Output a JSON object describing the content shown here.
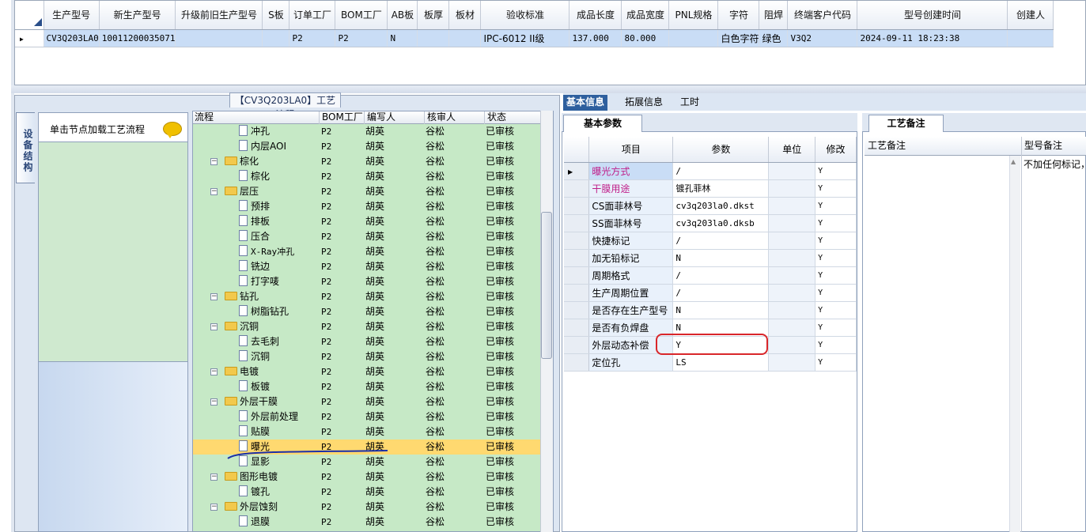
{
  "top_grid": {
    "columns": [
      "生产型号",
      "新生产型号",
      "升级前旧生产型号",
      "S板",
      "订单工厂",
      "BOM工厂",
      "AB板",
      "板厚",
      "板材",
      "验收标准",
      "成品长度",
      "成品宽度",
      "PNL规格",
      "字符",
      "阻焊",
      "终端客户代码",
      "型号创建时间",
      "创建人"
    ],
    "row": [
      "CV3Q203LA0",
      "10011200035071",
      "",
      "",
      "P2",
      "P2",
      "N",
      "",
      "",
      "IPC-6012 II级",
      "137.000",
      "80.000",
      "",
      "白色字符",
      "绿色",
      "V3Q2",
      "2024-09-11 18:23:38",
      ""
    ]
  },
  "flow_title": "【CV3Q203LA0】工艺流程",
  "side_tab": "设备结构",
  "load_hint": "单击节点加载工艺流程",
  "tree": {
    "headers": [
      "流程",
      "BOM工厂",
      "编写人",
      "核审人",
      "状态"
    ],
    "rows": [
      {
        "name": "冲孔",
        "level": 2,
        "bom": "P2",
        "writer": "胡英",
        "reviewer": "谷松",
        "status": "已审核"
      },
      {
        "name": "内层AOI",
        "level": 2,
        "bom": "P2",
        "writer": "胡英",
        "reviewer": "谷松",
        "status": "已审核"
      },
      {
        "name": "棕化",
        "level": 1,
        "bom": "P2",
        "writer": "胡英",
        "reviewer": "谷松",
        "status": "已审核"
      },
      {
        "name": "棕化",
        "level": 2,
        "bom": "P2",
        "writer": "胡英",
        "reviewer": "谷松",
        "status": "已审核"
      },
      {
        "name": "层压",
        "level": 1,
        "bom": "P2",
        "writer": "胡英",
        "reviewer": "谷松",
        "status": "已审核"
      },
      {
        "name": "预排",
        "level": 2,
        "bom": "P2",
        "writer": "胡英",
        "reviewer": "谷松",
        "status": "已审核"
      },
      {
        "name": "排板",
        "level": 2,
        "bom": "P2",
        "writer": "胡英",
        "reviewer": "谷松",
        "status": "已审核"
      },
      {
        "name": "压合",
        "level": 2,
        "bom": "P2",
        "writer": "胡英",
        "reviewer": "谷松",
        "status": "已审核"
      },
      {
        "name": "X-Ray冲孔",
        "level": 2,
        "bom": "P2",
        "writer": "胡英",
        "reviewer": "谷松",
        "status": "已审核"
      },
      {
        "name": "铣边",
        "level": 2,
        "bom": "P2",
        "writer": "胡英",
        "reviewer": "谷松",
        "status": "已审核"
      },
      {
        "name": "打字唛",
        "level": 2,
        "bom": "P2",
        "writer": "胡英",
        "reviewer": "谷松",
        "status": "已审核"
      },
      {
        "name": "钻孔",
        "level": 1,
        "bom": "P2",
        "writer": "胡英",
        "reviewer": "谷松",
        "status": "已审核"
      },
      {
        "name": "树脂钻孔",
        "level": 2,
        "bom": "P2",
        "writer": "胡英",
        "reviewer": "谷松",
        "status": "已审核"
      },
      {
        "name": "沉铜",
        "level": 1,
        "bom": "P2",
        "writer": "胡英",
        "reviewer": "谷松",
        "status": "已审核"
      },
      {
        "name": "去毛刺",
        "level": 2,
        "bom": "P2",
        "writer": "胡英",
        "reviewer": "谷松",
        "status": "已审核"
      },
      {
        "name": "沉铜",
        "level": 2,
        "bom": "P2",
        "writer": "胡英",
        "reviewer": "谷松",
        "status": "已审核"
      },
      {
        "name": "电镀",
        "level": 1,
        "bom": "P2",
        "writer": "胡英",
        "reviewer": "谷松",
        "status": "已审核"
      },
      {
        "name": "板镀",
        "level": 2,
        "bom": "P2",
        "writer": "胡英",
        "reviewer": "谷松",
        "status": "已审核"
      },
      {
        "name": "外层干膜",
        "level": 1,
        "bom": "P2",
        "writer": "胡英",
        "reviewer": "谷松",
        "status": "已审核"
      },
      {
        "name": "外层前处理",
        "level": 2,
        "bom": "P2",
        "writer": "胡英",
        "reviewer": "谷松",
        "status": "已审核"
      },
      {
        "name": "贴膜",
        "level": 2,
        "bom": "P2",
        "writer": "胡英",
        "reviewer": "谷松",
        "status": "已审核"
      },
      {
        "name": "曝光",
        "level": 2,
        "bom": "P2",
        "writer": "胡英",
        "reviewer": "谷松",
        "status": "已审核",
        "selected": true
      },
      {
        "name": "显影",
        "level": 2,
        "bom": "P2",
        "writer": "胡英",
        "reviewer": "谷松",
        "status": "已审核"
      },
      {
        "name": "图形电镀",
        "level": 1,
        "bom": "P2",
        "writer": "胡英",
        "reviewer": "谷松",
        "status": "已审核"
      },
      {
        "name": "镀孔",
        "level": 2,
        "bom": "P2",
        "writer": "胡英",
        "reviewer": "谷松",
        "status": "已审核"
      },
      {
        "name": "外层蚀刻",
        "level": 1,
        "bom": "P2",
        "writer": "胡英",
        "reviewer": "谷松",
        "status": "已审核"
      },
      {
        "name": "退膜",
        "level": 2,
        "bom": "P2",
        "writer": "胡英",
        "reviewer": "谷松",
        "status": "已审核"
      }
    ]
  },
  "right_tabs": [
    "基本信息",
    "拓展信息",
    "工时"
  ],
  "basic_tab": "基本参数",
  "params": {
    "headers": [
      "项目",
      "参数",
      "单位",
      "修改"
    ],
    "rows": [
      {
        "item": "曝光方式",
        "value": "/",
        "unit": "",
        "mod": "Y",
        "color": "#c0208a",
        "selected": true
      },
      {
        "item": "干膜用途",
        "value": "镀孔菲林",
        "unit": "",
        "mod": "Y",
        "color": "#c0208a"
      },
      {
        "item": "CS面菲林号",
        "value": "cv3q203la0.dkst",
        "unit": "",
        "mod": "Y",
        "color": "#000000"
      },
      {
        "item": "SS面菲林号",
        "value": "cv3q203la0.dksb",
        "unit": "",
        "mod": "Y",
        "color": "#000000"
      },
      {
        "item": "快捷标记",
        "value": "/",
        "unit": "",
        "mod": "Y",
        "color": "#000000"
      },
      {
        "item": "加无铅标记",
        "value": "N",
        "unit": "",
        "mod": "Y",
        "color": "#000000"
      },
      {
        "item": "周期格式",
        "value": "/",
        "unit": "",
        "mod": "Y",
        "color": "#000000"
      },
      {
        "item": "生产周期位置",
        "value": "/",
        "unit": "",
        "mod": "Y",
        "color": "#000000"
      },
      {
        "item": "是否存在生产型号",
        "value": "N",
        "unit": "",
        "mod": "Y",
        "color": "#000000"
      },
      {
        "item": "是否有负焊盘",
        "value": "N",
        "unit": "",
        "mod": "Y",
        "color": "#000000"
      },
      {
        "item": "外层动态补偿",
        "value": "Y",
        "unit": "",
        "mod": "Y",
        "color": "#000000"
      },
      {
        "item": "定位孔",
        "value": "LS",
        "unit": "",
        "mod": "Y",
        "color": "#000000"
      }
    ]
  },
  "craft": {
    "tab": "工艺备注",
    "col1": "工艺备注",
    "col2": "型号备注",
    "model_note": "不加任何标记，"
  },
  "colors": {
    "selected_row": "#ffd970",
    "tree_bg": "#c6e9c6",
    "accent": "#2e5f9e",
    "annotation_red": "#d9262a",
    "annotation_blue": "#1b2fa8"
  }
}
